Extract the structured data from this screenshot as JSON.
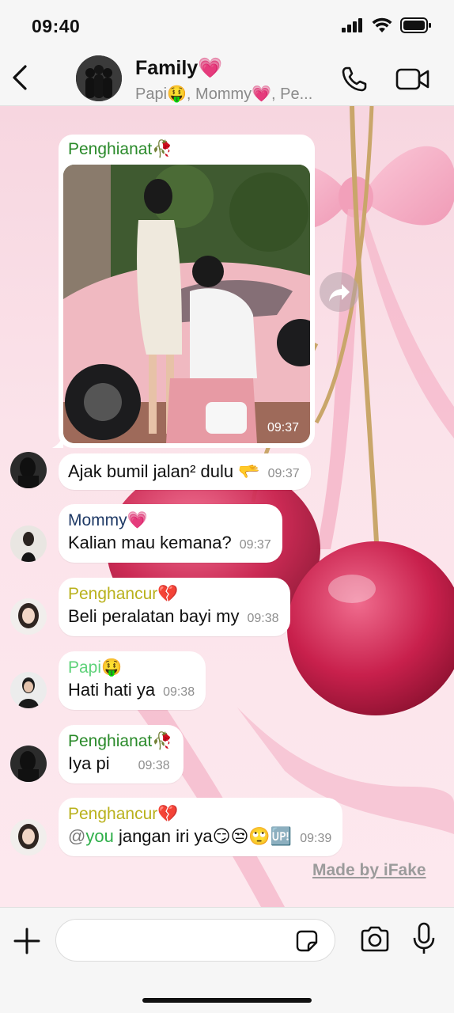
{
  "status_bar": {
    "time": "09:40"
  },
  "header": {
    "title": "Family💗",
    "subtitle": "Papi🤑, Mommy💗, Pe..."
  },
  "colors": {
    "penghianat": "#2a8a2a",
    "mommy": "#1f3a66",
    "penghancur": "#b9b11c",
    "papi": "#5fd27a",
    "mention": "#2faf4a"
  },
  "messages": [
    {
      "sender": "Penghianat🥀",
      "type": "photo",
      "time": "09:37"
    },
    {
      "sender": "",
      "text": "Ajak bumil jalan² dulu 🫳",
      "time": "09:37"
    },
    {
      "sender": "Mommy💗",
      "text": "Kalian mau kemana?",
      "time": "09:37"
    },
    {
      "sender": "Penghancur💔",
      "text": "Beli peralatan bayi my",
      "time": "09:38"
    },
    {
      "sender": "Papi🤑",
      "text": "Hati hati ya",
      "time": "09:38"
    },
    {
      "sender": "Penghianat🥀",
      "text": "Iya pi",
      "time": "09:38"
    },
    {
      "sender": "Penghancur💔",
      "mention": "@you",
      "text": " jangan iri ya😏😒🙄🆙",
      "time": "09:39"
    }
  ],
  "footer_credit": "Made by iFake",
  "icons": [
    "back-icon",
    "phone-icon",
    "video-icon",
    "forward-icon",
    "plus-icon",
    "sticker-icon",
    "camera-icon",
    "mic-icon"
  ]
}
